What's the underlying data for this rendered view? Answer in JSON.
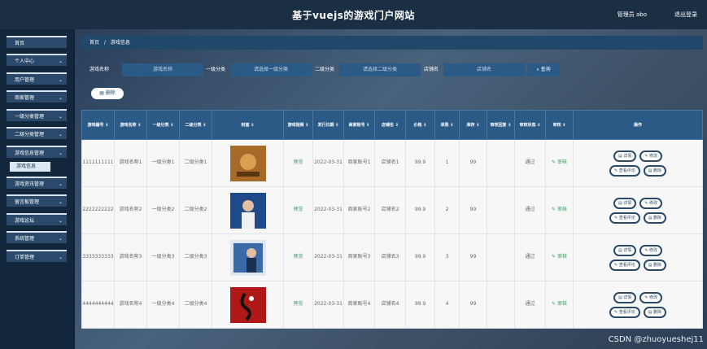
{
  "header": {
    "title": "基于vuejs的游戏门户网站",
    "user": "管理员 abo",
    "logout": "退出登录"
  },
  "sidebar": {
    "items": [
      {
        "label": "首页",
        "chev": ""
      },
      {
        "label": "个人中心",
        "chev": "⌄"
      },
      {
        "label": "用户管理",
        "chev": "⌄"
      },
      {
        "label": "商家管理",
        "chev": "⌄"
      },
      {
        "label": "一级分类管理",
        "chev": "⌄"
      },
      {
        "label": "二级分类管理",
        "chev": "⌄"
      },
      {
        "label": "游戏信息管理",
        "chev": "⌄"
      },
      {
        "label": "游戏资讯管理",
        "chev": "⌄"
      },
      {
        "label": "留言板管理",
        "chev": "⌄"
      },
      {
        "label": "游戏论坛",
        "chev": "⌄"
      },
      {
        "label": "系统管理",
        "chev": "⌄"
      },
      {
        "label": "订单管理",
        "chev": "⌄"
      }
    ],
    "submenu": "游戏信息"
  },
  "breadcrumb": {
    "home": "首页",
    "sep": "/",
    "current": "游戏信息"
  },
  "filters": {
    "name_label": "游戏名称",
    "name_placeholder": "游戏名称",
    "cat1_label": "一级分类",
    "cat1_placeholder": "请选择一级分类",
    "cat2_label": "二级分类",
    "cat2_placeholder": "请选择二级分类",
    "shop_label": "店铺名",
    "shop_placeholder": "店铺名",
    "search": "查询"
  },
  "toolbar": {
    "delete": "删除"
  },
  "table": {
    "headers": [
      "游戏编号 ⇕",
      "游戏名称 ⇕",
      "一级分类 ⇕",
      "二级分类 ⇕",
      "封面 ⇕",
      "游戏视频 ⇕",
      "发行日期 ⇕",
      "商家账号 ⇕",
      "店铺名 ⇕",
      "价格 ⇕",
      "单限 ⇕",
      "库存 ⇕",
      "审核回复 ⇕",
      "审核状态 ⇕",
      "审核 ⇕",
      "操作"
    ],
    "rows": [
      {
        "id": "1111111111",
        "name": "游戏名称1",
        "cat1": "一级分类1",
        "cat2": "二级分类1",
        "video": "预览",
        "date": "2022-03-31",
        "merchant": "商家账号1",
        "shop": "店铺名1",
        "price": "99.9",
        "limit": "1",
        "stock": "99",
        "reply": "",
        "status": "通过",
        "audit": "审核",
        "color": "#a86a2a"
      },
      {
        "id": "2222222222",
        "name": "游戏名称2",
        "cat1": "一级分类2",
        "cat2": "二级分类2",
        "video": "预览",
        "date": "2022-03-31",
        "merchant": "商家账号2",
        "shop": "店铺名2",
        "price": "99.9",
        "limit": "2",
        "stock": "99",
        "reply": "",
        "status": "通过",
        "audit": "审核",
        "color": "#1e4a8a"
      },
      {
        "id": "3333333333",
        "name": "游戏名称3",
        "cat1": "一级分类3",
        "cat2": "二级分类3",
        "video": "预览",
        "date": "2022-03-31",
        "merchant": "商家账号3",
        "shop": "店铺名3",
        "price": "99.9",
        "limit": "3",
        "stock": "99",
        "reply": "",
        "status": "通过",
        "audit": "审核",
        "color": "#3a6aa8"
      },
      {
        "id": "4444444444",
        "name": "游戏名称4",
        "cat1": "一级分类4",
        "cat2": "二级分类4",
        "video": "预览",
        "date": "2022-03-31",
        "merchant": "商家账号4",
        "shop": "店铺名4",
        "price": "99.9",
        "limit": "4",
        "stock": "99",
        "reply": "",
        "status": "通过",
        "audit": "审核",
        "color": "#b01818"
      }
    ],
    "ops": {
      "detail": "详情",
      "edit": "修改",
      "reviews": "查看评论",
      "delete": "删除"
    }
  },
  "watermark": "CSDN @zhuoyueshej11"
}
